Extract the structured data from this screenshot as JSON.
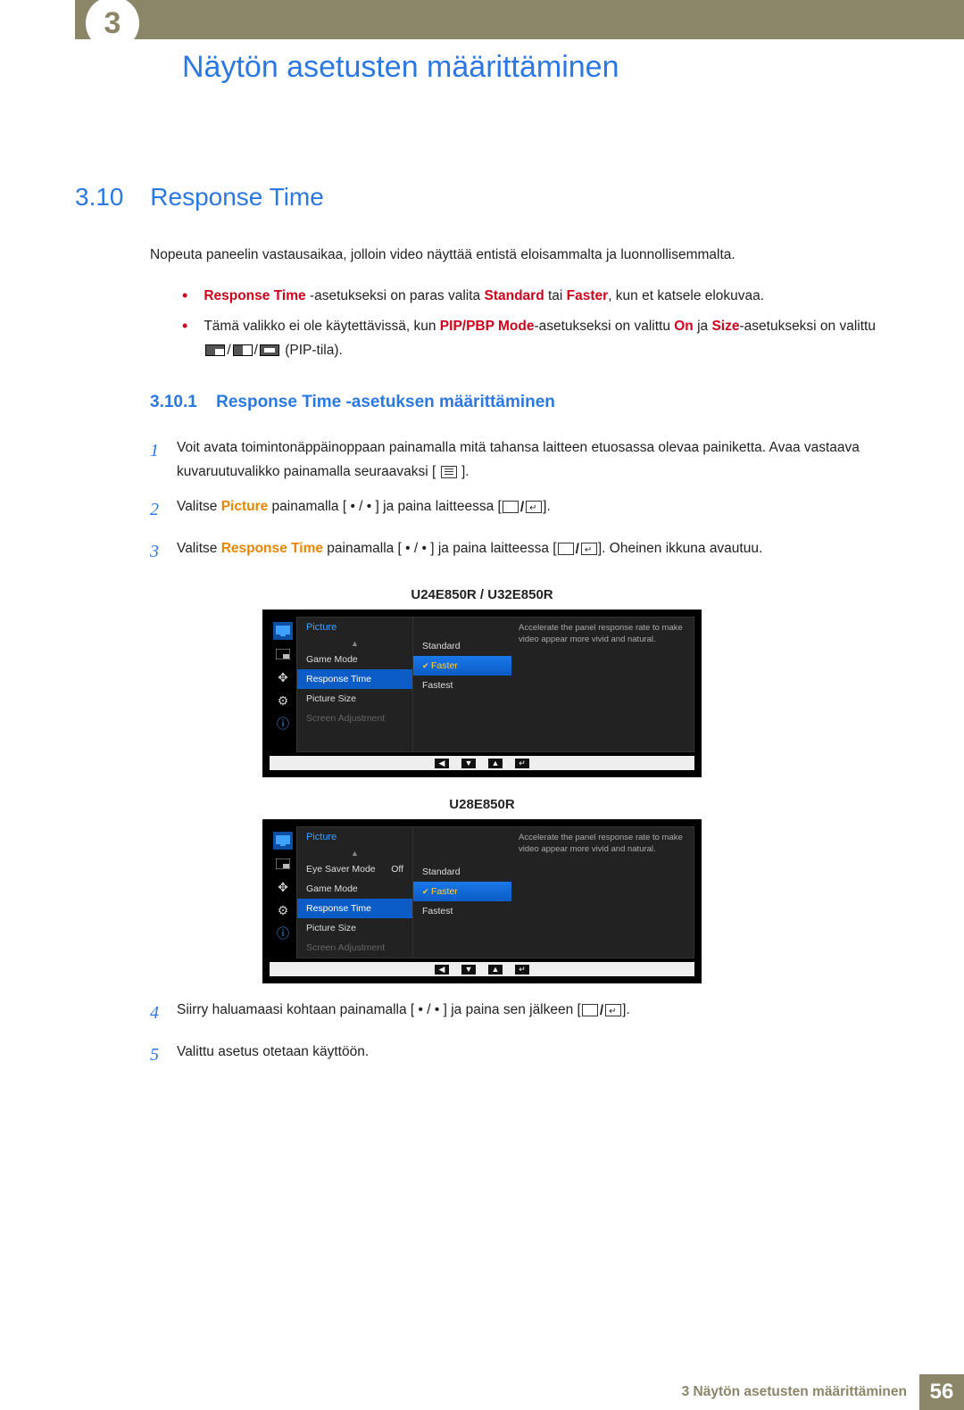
{
  "chapter_tab": "3",
  "page_title": "Näytön asetusten määrittäminen",
  "section_num": "3.10",
  "section_title": "Response Time",
  "intro": "Nopeuta paneelin vastausaikaa, jolloin video näyttää entistä eloisammalta ja luonnollisemmalta.",
  "bullet1": {
    "a": "Response Time",
    "b": " -asetukseksi on paras valita ",
    "c": "Standard",
    "d": " tai ",
    "e": "Faster",
    "f": ", kun et katsele elokuvaa."
  },
  "bullet2": {
    "a": "Tämä valikko ei ole käytettävissä, kun ",
    "b": "PIP/PBP Mode",
    "c": "-asetukseksi on valittu ",
    "d": "On",
    "e": " ja ",
    "f": "Size",
    "g": "-asetukseksi on valittu ",
    "h": " (PIP-tila)."
  },
  "sub_num": "3.10.1",
  "sub_title": "Response Time -asetuksen määrittäminen",
  "step1": "Voit avata toimintonäppäinoppaan painamalla mitä tahansa laitteen etuosassa olevaa painiketta. Avaa vastaava kuvaruutuvalikko painamalla seuraavaksi [",
  "step1_end": "].",
  "step2_a": "Valitse ",
  "step2_b": "Picture",
  "step2_c": " painamalla [ • / • ] ja paina laitteessa [",
  "step2_end": "].",
  "step3_a": "Valitse ",
  "step3_b": "Response Time",
  "step3_c": " painamalla [ • / • ] ja paina laitteessa [",
  "step3_d": "]. Oheinen ikkuna avautuu.",
  "step4": "Siirry haluamaasi kohtaan painamalla [ • / • ] ja paina sen jälkeen [",
  "step4_end": "].",
  "step5": "Valittu asetus otetaan käyttöön.",
  "model1_label": "U24E850R / U32E850R",
  "model2_label": "U28E850R",
  "osd": {
    "header": "Picture",
    "items1": [
      "Game Mode",
      "Response Time",
      "Picture Size",
      "Screen Adjustment"
    ],
    "items2": [
      {
        "label": "Eye Saver Mode",
        "val": "Off"
      },
      {
        "label": "Game Mode",
        "val": ""
      },
      {
        "label": "Response Time",
        "val": ""
      },
      {
        "label": "Picture Size",
        "val": ""
      },
      {
        "label": "Screen Adjustment",
        "val": ""
      }
    ],
    "options": [
      "Standard",
      "Faster",
      "Fastest"
    ],
    "desc": "Accelerate the panel response rate to make video appear more vivid and natural."
  },
  "footer_text": "3 Näytön asetusten määrittäminen",
  "footer_page": "56"
}
